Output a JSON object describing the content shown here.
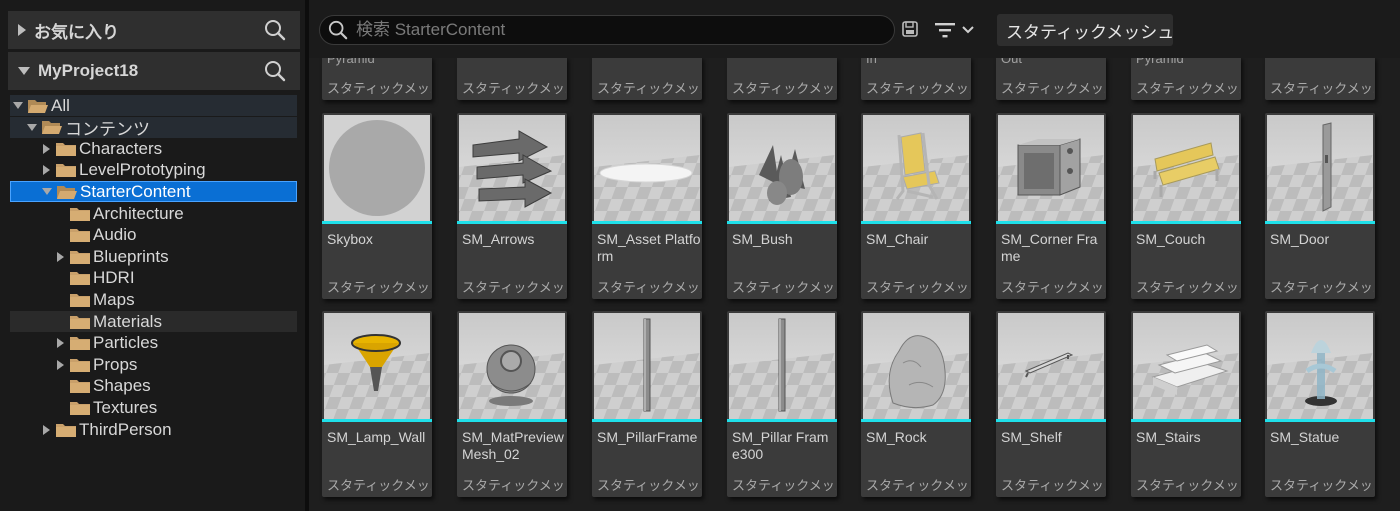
{
  "favorites": {
    "title": "お気に入り"
  },
  "project": {
    "title": "MyProject18"
  },
  "tree": [
    {
      "label": "All",
      "level": 0,
      "arrow": "down",
      "state": "hl"
    },
    {
      "label": "コンテンツ",
      "level": 1,
      "arrow": "down",
      "state": "hl"
    },
    {
      "label": "Characters",
      "level": 2,
      "arrow": "right",
      "state": ""
    },
    {
      "label": "LevelPrototyping",
      "level": 2,
      "arrow": "right",
      "state": ""
    },
    {
      "label": "StarterContent",
      "level": 2,
      "arrow": "down",
      "state": "sel"
    },
    {
      "label": "Architecture",
      "level": 3,
      "arrow": "",
      "state": ""
    },
    {
      "label": "Audio",
      "level": 3,
      "arrow": "",
      "state": ""
    },
    {
      "label": "Blueprints",
      "level": 3,
      "arrow": "right",
      "state": ""
    },
    {
      "label": "HDRI",
      "level": 3,
      "arrow": "",
      "state": ""
    },
    {
      "label": "Maps",
      "level": 3,
      "arrow": "",
      "state": ""
    },
    {
      "label": "Materials",
      "level": 3,
      "arrow": "",
      "state": "hov"
    },
    {
      "label": "Particles",
      "level": 3,
      "arrow": "right",
      "state": ""
    },
    {
      "label": "Props",
      "level": 3,
      "arrow": "right",
      "state": ""
    },
    {
      "label": "Shapes",
      "level": 3,
      "arrow": "",
      "state": ""
    },
    {
      "label": "Textures",
      "level": 3,
      "arrow": "",
      "state": ""
    },
    {
      "label": "ThirdPerson",
      "level": 2,
      "arrow": "right",
      "state": ""
    }
  ],
  "search": {
    "placeholder": "検索 StarterContent"
  },
  "filter_chip": {
    "label": "スタティックメッシュ"
  },
  "asset_type": "スタティックメッ...",
  "partial_row": [
    {
      "name": "Pyramid"
    },
    {
      "name": ""
    },
    {
      "name": ""
    },
    {
      "name": ""
    },
    {
      "name": "In"
    },
    {
      "name": "Out"
    },
    {
      "name": "Pyramid"
    },
    {
      "name": ""
    }
  ],
  "assets_row1": [
    {
      "name": "Skybox",
      "icon": "sphere-thumbnail"
    },
    {
      "name": "SM_Arrows",
      "icon": "arrows-thumbnail"
    },
    {
      "name": "SM_Asset Platform",
      "icon": "platform-thumbnail"
    },
    {
      "name": "SM_Bush",
      "icon": "bush-thumbnail"
    },
    {
      "name": "SM_Chair",
      "icon": "chair-thumbnail"
    },
    {
      "name": "SM_Corner Frame",
      "icon": "corner-frame-thumbnail"
    },
    {
      "name": "SM_Couch",
      "icon": "couch-thumbnail"
    },
    {
      "name": "SM_Door",
      "icon": "door-thumbnail"
    }
  ],
  "assets_row2": [
    {
      "name": "SM_Lamp_Wall",
      "icon": "lamp-thumbnail"
    },
    {
      "name": "SM_MatPreview Mesh_02",
      "icon": "mat-preview-thumbnail"
    },
    {
      "name": "SM_PillarFrame",
      "icon": "pillar-thumbnail"
    },
    {
      "name": "SM_Pillar Frame300",
      "icon": "pillar-thumbnail"
    },
    {
      "name": "SM_Rock",
      "icon": "rock-thumbnail"
    },
    {
      "name": "SM_Shelf",
      "icon": "shelf-thumbnail"
    },
    {
      "name": "SM_Stairs",
      "icon": "stairs-thumbnail"
    },
    {
      "name": "SM_Statue",
      "icon": "statue-thumbnail"
    }
  ],
  "colors": {
    "accent": "#1fe0ea",
    "selection": "#0a6fd4",
    "folder": "#c9a06a"
  }
}
